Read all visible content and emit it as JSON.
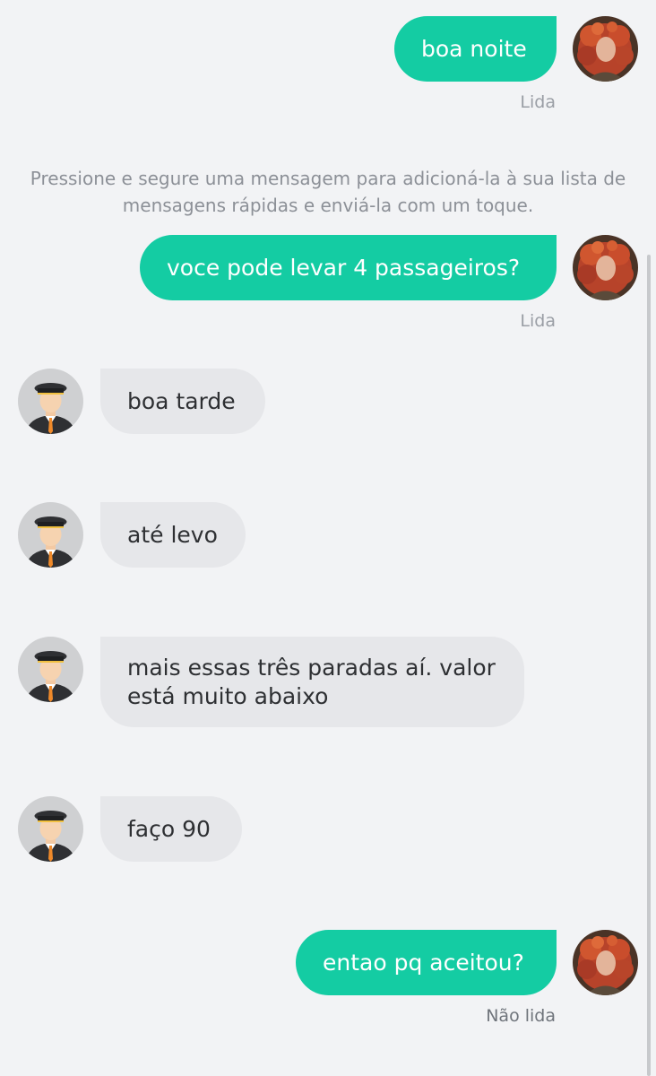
{
  "messages": [
    {
      "text": "boa noite",
      "status": "Lida"
    },
    {
      "text": "voce pode levar 4 passageiros?",
      "status": "Lida"
    },
    {
      "text": "boa tarde"
    },
    {
      "text": "até levo"
    },
    {
      "text": "mais essas três paradas aí. valor está muito abaixo"
    },
    {
      "text": "faço 90"
    },
    {
      "text": "entao pq aceitou?",
      "status": "Não lida"
    }
  ],
  "hint": "Pressione e segure uma mensagem para adicioná-la à sua lista de mensagens rápidas e enviá-la com um toque.",
  "icons": {
    "user_avatar": "user-avatar",
    "driver_avatar": "driver-avatar"
  },
  "colors": {
    "outgoing_bubble": "#14cca3",
    "incoming_bubble": "#e6e7ea",
    "background": "#f2f3f5"
  }
}
